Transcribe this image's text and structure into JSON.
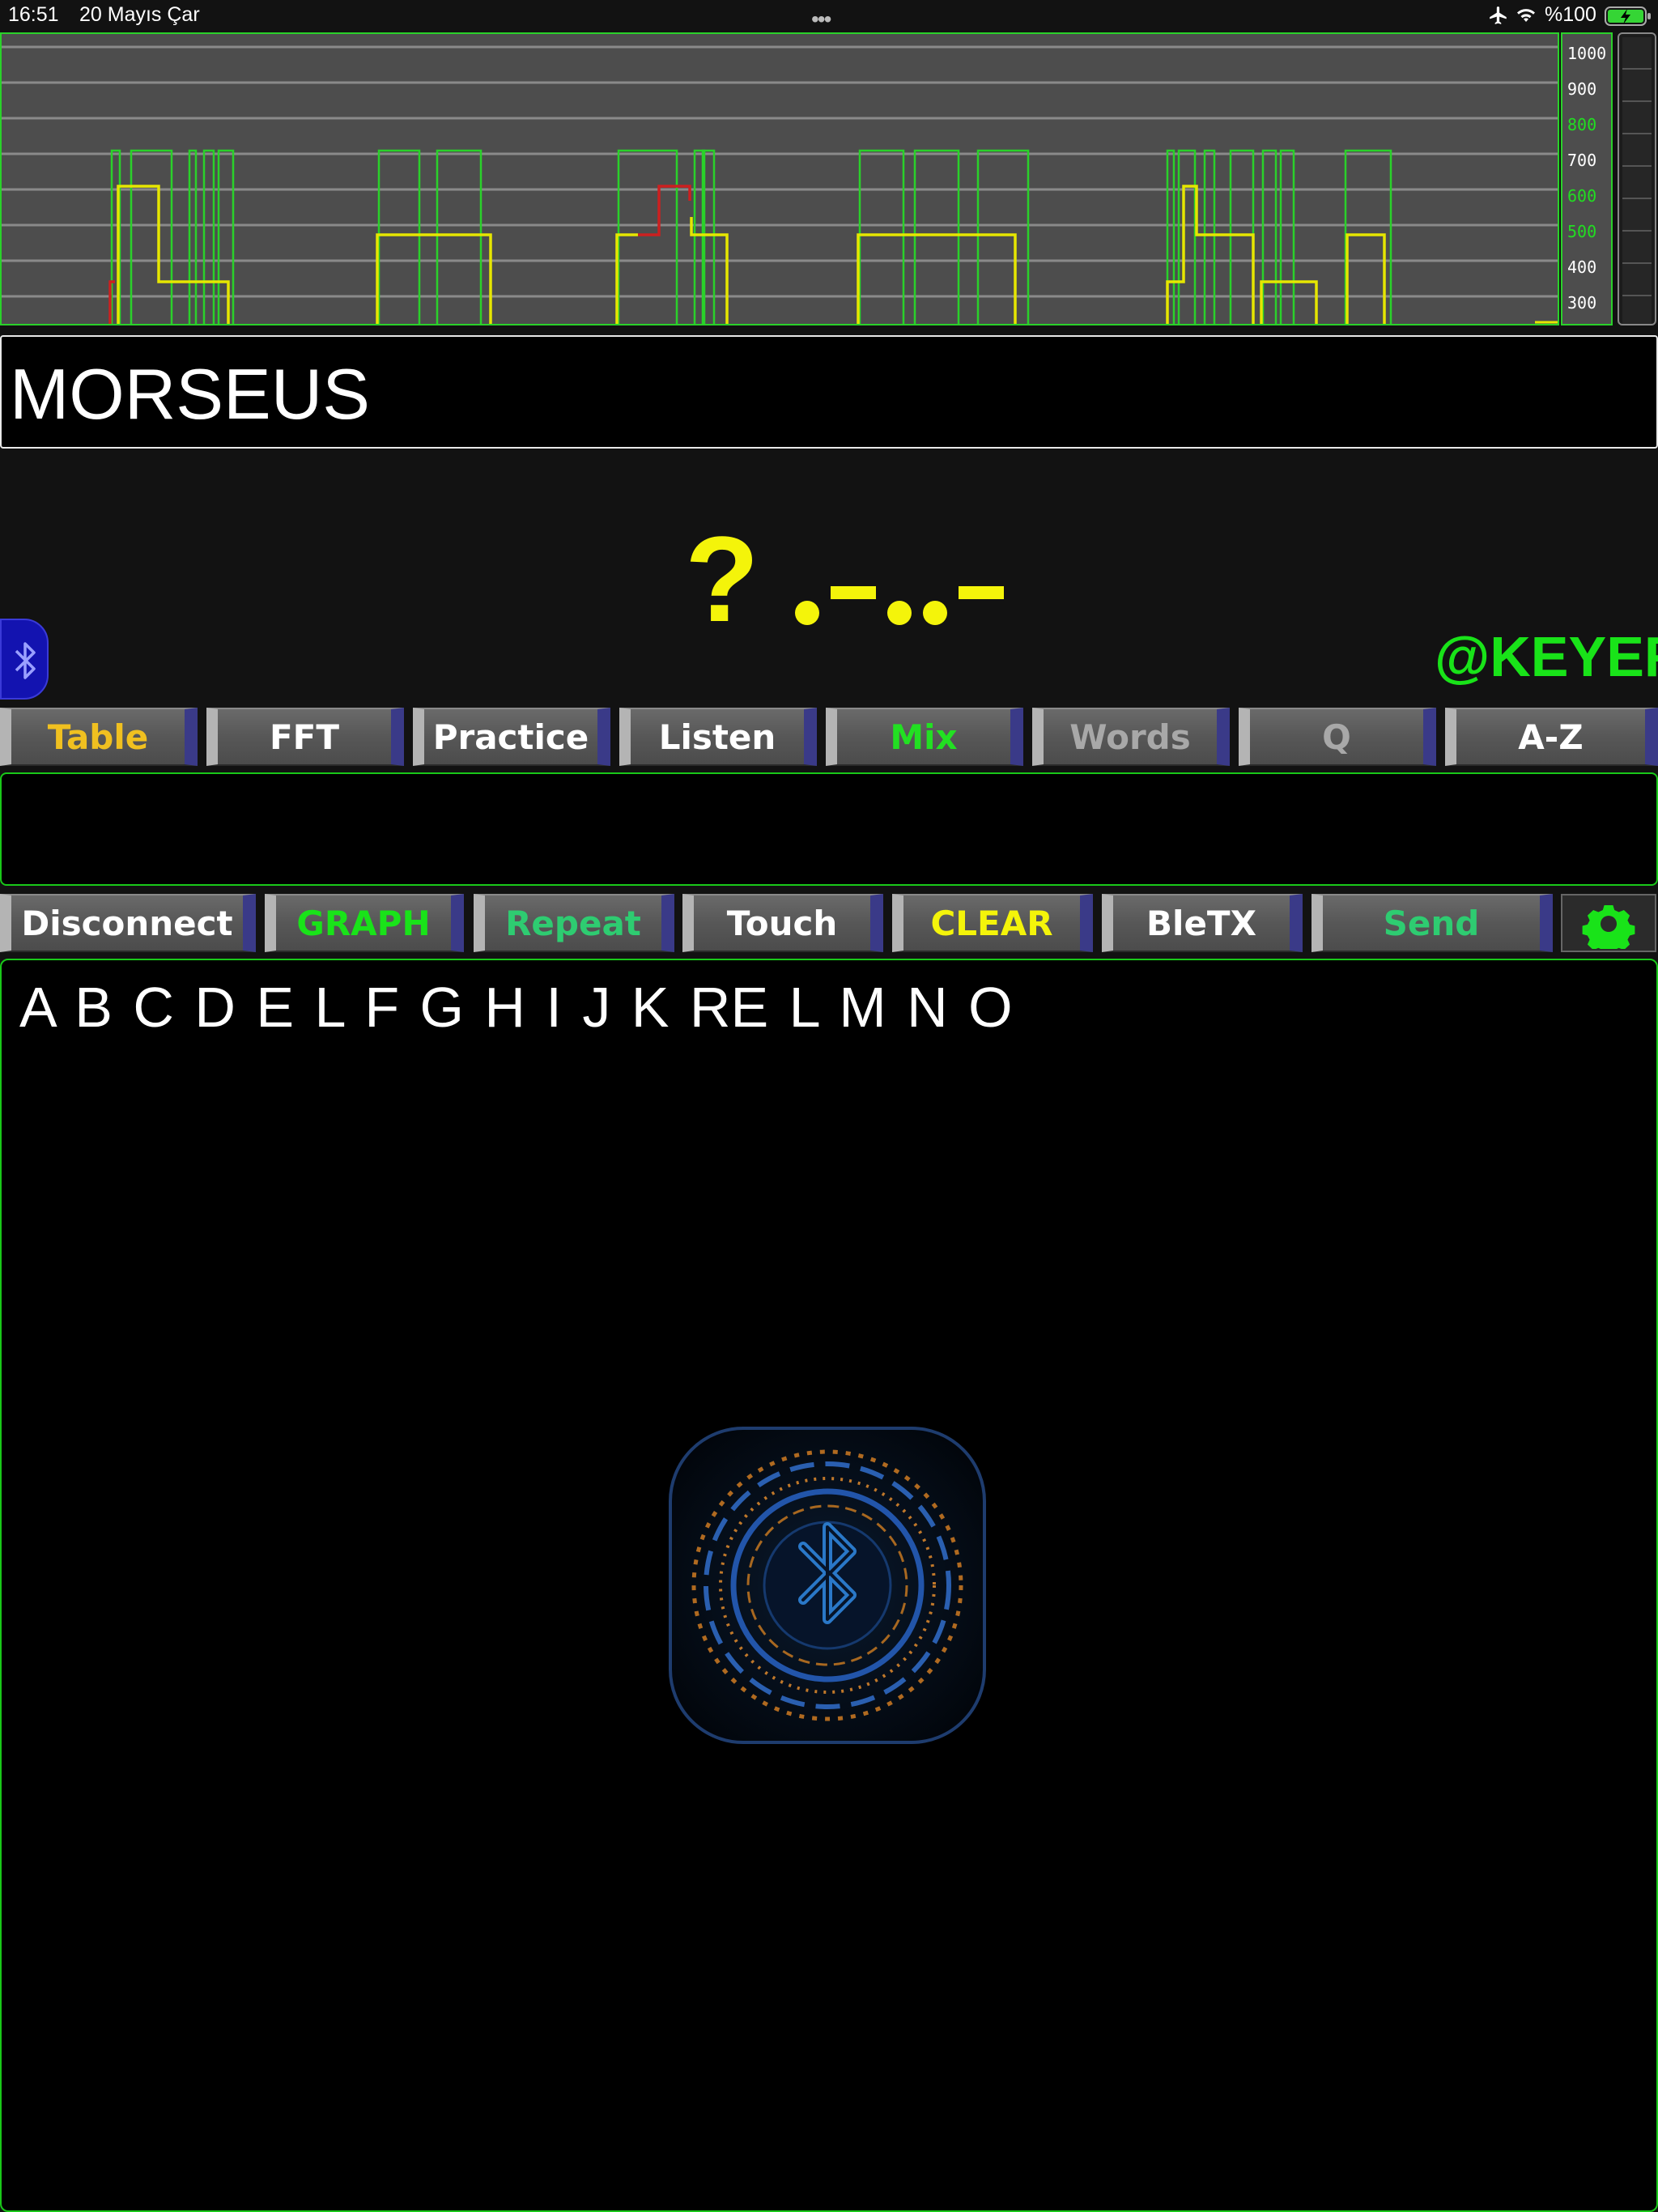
{
  "status_bar": {
    "time": "16:51",
    "date": "20 Mayıs Çar",
    "battery": "%100",
    "icons": [
      "airplane-icon",
      "wifi-icon",
      "battery-charging-icon"
    ]
  },
  "graph": {
    "scale_labels": [
      "1000",
      "900",
      "800",
      "700",
      "600",
      "500",
      "400",
      "300"
    ],
    "scale_colors": [
      "#ffffff",
      "#ffffff",
      "#22dd22",
      "#ffffff",
      "#22dd22",
      "#22dd22",
      "#ffffff",
      "#ffffff"
    ]
  },
  "title": "MORSEUS",
  "decoded": {
    "character": "?",
    "morse": ".-..-"
  },
  "keyer_label": "@KEYER",
  "mode_tabs": [
    {
      "label": "Table",
      "color": "#f0c020"
    },
    {
      "label": "FFT",
      "color": "#ffffff"
    },
    {
      "label": "Practice",
      "color": "#ffffff"
    },
    {
      "label": "Listen",
      "color": "#ffffff"
    },
    {
      "label": "Mix",
      "color": "#22e022"
    },
    {
      "label": "Words",
      "color": "#a8a8a8"
    },
    {
      "label": "Q",
      "color": "#a8a8a8"
    },
    {
      "label": "A-Z",
      "color": "#ffffff"
    }
  ],
  "action_buttons": [
    {
      "label": "Disconnect",
      "color": "#ffffff"
    },
    {
      "label": "GRAPH",
      "color": "#19e319"
    },
    {
      "label": "Repeat",
      "color": "#2ecc71"
    },
    {
      "label": "Touch",
      "color": "#ffffff"
    },
    {
      "label": "CLEAR",
      "color": "#f4f40a"
    },
    {
      "label": "BleTX",
      "color": "#ffffff"
    },
    {
      "label": "Send",
      "color": "#2ecc71"
    }
  ],
  "received_text": "A B C D E L F G H I J K RE L M N O",
  "colors": {
    "accent_green": "#19c819",
    "signal_yellow": "#f4f40a",
    "signal_red": "#cc2020",
    "graph_bg": "#4d4d4d"
  }
}
